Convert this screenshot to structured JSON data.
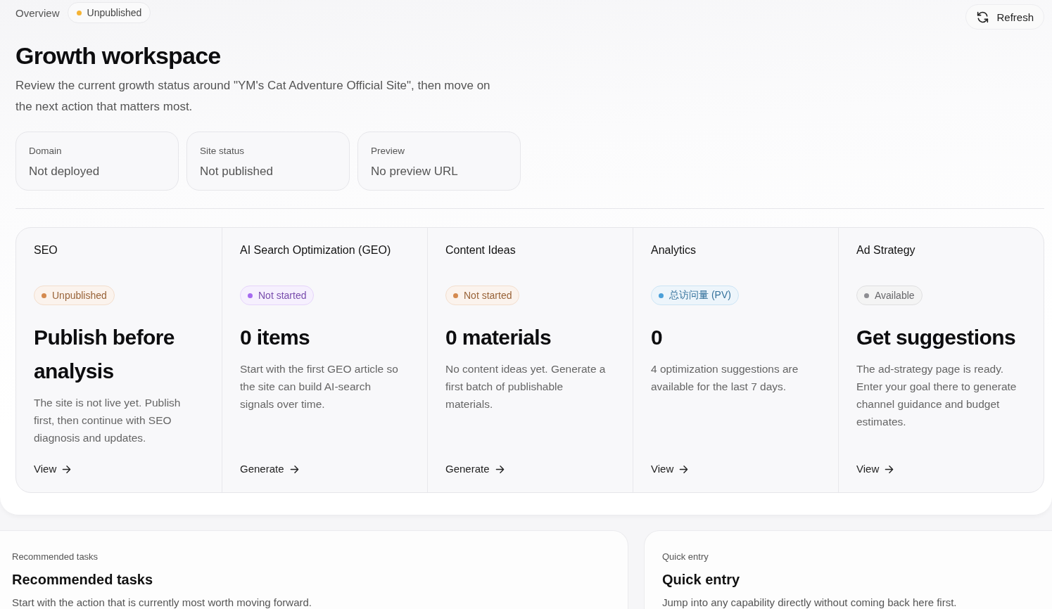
{
  "header": {
    "breadcrumb": "Overview",
    "status": {
      "label": "Unpublished",
      "color": "#f5b335"
    },
    "refresh_button": "Refresh"
  },
  "title": "Growth workspace",
  "description": "Review the current growth status around \"YM's Cat Adventure Official Site\", then move on the next action that matters most.",
  "info_cards": [
    {
      "label": "Domain",
      "value": "Not deployed"
    },
    {
      "label": "Site status",
      "value": "Not published"
    },
    {
      "label": "Preview",
      "value": "No preview URL"
    }
  ],
  "modules": [
    {
      "title": "SEO",
      "badge": {
        "label": "Unpublished",
        "color": "#d4894e"
      },
      "headline": "Publish before analysis",
      "description": "The site is not live yet. Publish first, then continue with SEO diagnosis and updates.",
      "link": "View"
    },
    {
      "title": "AI Search Optimization (GEO)",
      "badge": {
        "label": "Not started",
        "color": "#a66af0"
      },
      "headline": "0 items",
      "description": "Start with the first GEO article so the site can build AI-search signals over time.",
      "link": "Generate"
    },
    {
      "title": "Content Ideas",
      "badge": {
        "label": "Not started",
        "color": "#d4894e"
      },
      "headline": "0 materials",
      "description": "No content ideas yet. Generate a first batch of publishable materials.",
      "link": "Generate"
    },
    {
      "title": "Analytics",
      "badge": {
        "label": "总访问量 (PV)",
        "color": "#4a9fd8"
      },
      "headline": "0",
      "description": "4 optimization suggestions are available for the last 7 days.",
      "link": "View"
    },
    {
      "title": "Ad Strategy",
      "badge": {
        "label": "Available",
        "color": "#8d8d92"
      },
      "headline": "Get suggestions",
      "description": "The ad-strategy page is ready. Enter your goal there to generate channel guidance and budget estimates.",
      "link": "View"
    }
  ],
  "panels": [
    {
      "eyebrow": "Recommended tasks",
      "title": "Recommended tasks",
      "description": "Start with the action that is currently most worth moving forward."
    },
    {
      "eyebrow": "Quick entry",
      "title": "Quick entry",
      "description": "Jump into any capability directly without coming back here first."
    }
  ]
}
